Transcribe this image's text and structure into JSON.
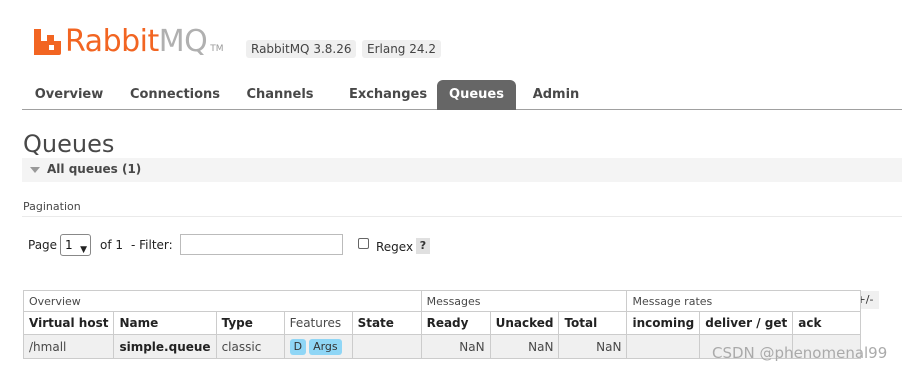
{
  "app": {
    "logo_rabbit": "Rabbit",
    "logo_mq": "MQ",
    "logo_tm": "TM",
    "rabbitmq_version": "RabbitMQ 3.8.26",
    "erlang_version": "Erlang 24.2"
  },
  "nav": {
    "tabs": [
      {
        "label": "Overview"
      },
      {
        "label": "Connections"
      },
      {
        "label": "Channels"
      },
      {
        "label": "Exchanges"
      },
      {
        "label": "Queues",
        "active": true
      },
      {
        "label": "Admin"
      }
    ]
  },
  "page": {
    "title": "Queues",
    "section_label": "All queues (1)"
  },
  "pagination": {
    "label": "Pagination",
    "page_text": "Page",
    "page_value": "1",
    "of_text": "of 1",
    "filter_label": "- Filter:",
    "filter_value": "",
    "regex_label": "Regex",
    "help": "?"
  },
  "table": {
    "toggle": "+/-",
    "groups": [
      "Overview",
      "Messages",
      "Message rates"
    ],
    "columns": [
      "Virtual host",
      "Name",
      "Type",
      "Features",
      "State",
      "Ready",
      "Unacked",
      "Total",
      "incoming",
      "deliver / get",
      "ack"
    ],
    "rows": [
      {
        "virtual_host": "/hmall",
        "name": "simple.queue",
        "type": "classic",
        "features": [
          "D",
          "Args"
        ],
        "state": "",
        "ready": "NaN",
        "unacked": "NaN",
        "total": "NaN",
        "incoming": "",
        "deliver_get": "",
        "ack": ""
      }
    ]
  },
  "watermark": "CSDN @phenomenal99",
  "colors": {
    "brand_orange": "#f26522",
    "tab_active": "#666666",
    "feature_tag": "#8fd6f6"
  }
}
